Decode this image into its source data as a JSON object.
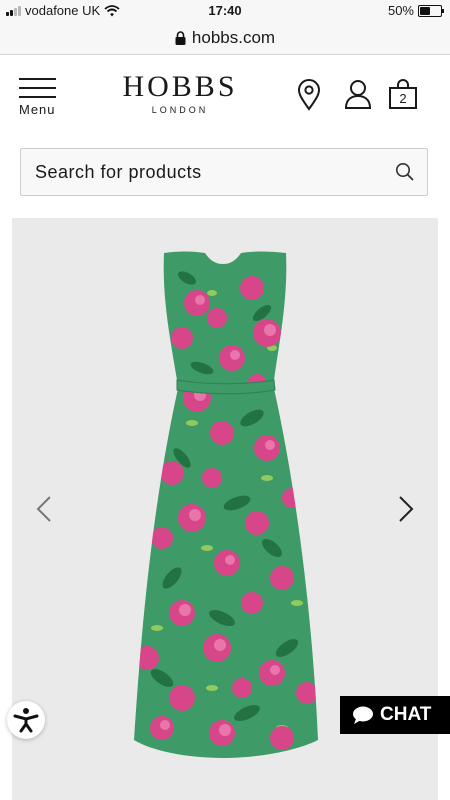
{
  "status_bar": {
    "carrier": "vodafone UK",
    "time": "17:40",
    "battery": "50%"
  },
  "browser": {
    "url": "hobbs.com"
  },
  "header": {
    "menu_label": "Menu",
    "logo_main": "HOBBS",
    "logo_sub": "LONDON",
    "bag_count": "2"
  },
  "search": {
    "placeholder": "Search for products"
  },
  "product": {
    "image": "floral-green-maxi-dress"
  },
  "chat": {
    "label": "CHAT"
  },
  "colors": {
    "dress_green": "#3e9a67",
    "flower_pink": "#d8468a",
    "panel_bg": "#eaeaea"
  }
}
